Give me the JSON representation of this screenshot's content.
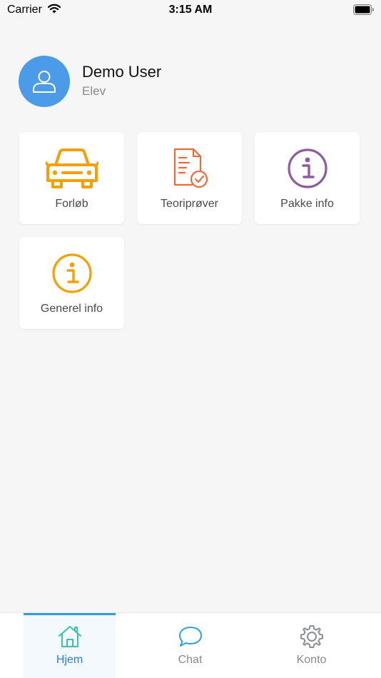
{
  "status_bar": {
    "carrier": "Carrier",
    "time": "3:15 AM",
    "icons": [
      "wifi-icon",
      "battery-icon"
    ]
  },
  "profile": {
    "name": "Demo User",
    "role": "Elev",
    "icon": "user-icon"
  },
  "tiles": [
    {
      "label": "Forløb",
      "icon": "car-icon",
      "color": "#f5a000"
    },
    {
      "label": "Teoriprøver",
      "icon": "document-check-icon",
      "color": "#ef6a3a"
    },
    {
      "label": "Pakke info",
      "icon": "info-circle-icon",
      "color": "#8e5aa6"
    },
    {
      "label": "Generel info",
      "icon": "info-circle-icon",
      "color": "#f5a000"
    }
  ],
  "tab_bar": {
    "active_tab": "Hjem",
    "accent_color": "#2b9fe6",
    "tabs": [
      {
        "label": "Hjem",
        "icon": "home-icon",
        "color": "#3cc1b0"
      },
      {
        "label": "Chat",
        "icon": "chat-bubble-icon",
        "color": "#2b9fe6"
      },
      {
        "label": "Konto",
        "icon": "gear-icon",
        "color": "#8a8f96"
      }
    ]
  }
}
